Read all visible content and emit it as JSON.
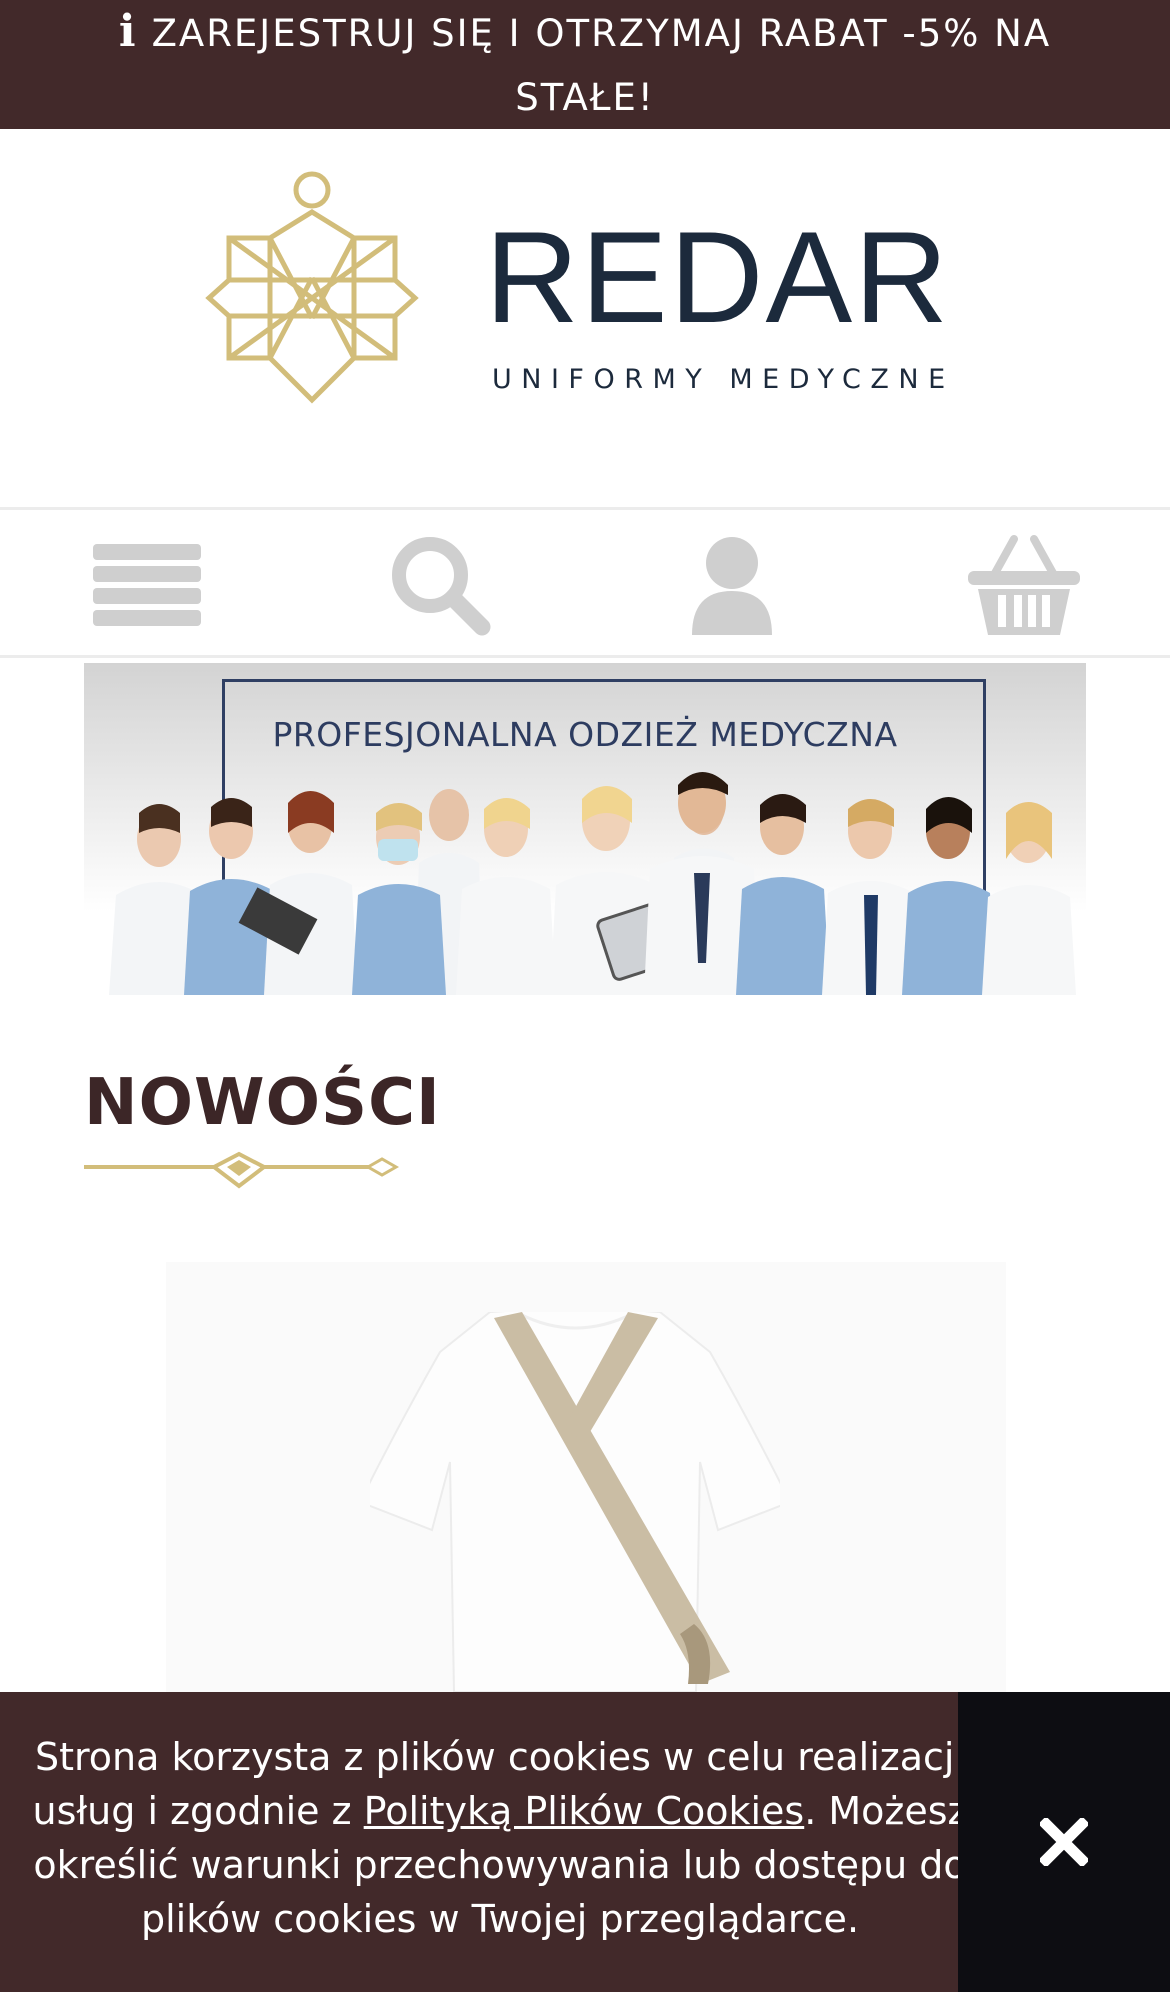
{
  "promo": {
    "text": "ZAREJESTRUJ SIĘ I OTRZYMAJ RABAT -5% NA STAŁE!",
    "icon": "info-icon"
  },
  "brand": {
    "name": "REDAR",
    "tagline": "UNIFORMY MEDYCZNE"
  },
  "nav": {
    "items": [
      {
        "icon": "hamburger-menu-icon"
      },
      {
        "icon": "search-icon"
      },
      {
        "icon": "user-account-icon"
      },
      {
        "icon": "shopping-basket-icon"
      }
    ]
  },
  "banner": {
    "title": "PROFESJONALNA ODZIEŻ MEDYCZNA"
  },
  "section": {
    "title": "NOWOŚCI"
  },
  "cookie": {
    "text_before": "Strona korzysta z plików cookies w celu realizacji usług i zgodnie z ",
    "link": "Polityką Plików Cookies",
    "text_after": ". Możesz określić warunki przechowywania lub dostępu do plików cookies w Twojej przeglądarce.",
    "close_icon": "close-icon"
  },
  "colors": {
    "brown": "#42292a",
    "navy": "#1c2a3c",
    "gold": "#d2bd7a",
    "icon_gray": "#cfcfcf",
    "dark": "#0d0d12"
  }
}
